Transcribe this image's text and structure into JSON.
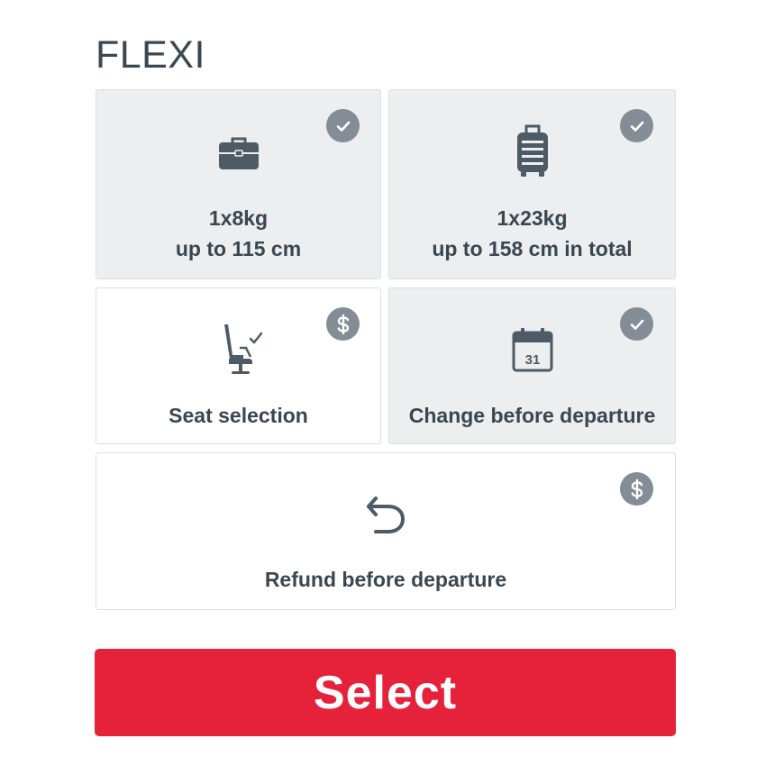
{
  "fare": {
    "name": "FLEXI"
  },
  "features": {
    "cabin_bag": {
      "line1": "1x8kg",
      "line2": "up to 115 cm",
      "status_icon": "check-icon",
      "icon": "briefcase-icon"
    },
    "checked_bag": {
      "line1": "1x23kg",
      "line2": "up to 158 cm in total",
      "status_icon": "check-icon",
      "icon": "suitcase-icon"
    },
    "seat_selection": {
      "label": "Seat selection",
      "status_icon": "dollar-icon",
      "icon": "seat-icon"
    },
    "change": {
      "label": "Change before departure",
      "status_icon": "check-icon",
      "icon": "calendar-icon",
      "calendar_day": "31"
    },
    "refund": {
      "label": "Refund before departure",
      "status_icon": "dollar-icon",
      "icon": "undo-arrow-icon"
    }
  },
  "actions": {
    "select_label": "Select"
  },
  "colors": {
    "accent": "#e6213a",
    "included_bg": "#eceef0",
    "badge": "#848d95",
    "icon": "#4d5b66",
    "text": "#3a4650"
  }
}
